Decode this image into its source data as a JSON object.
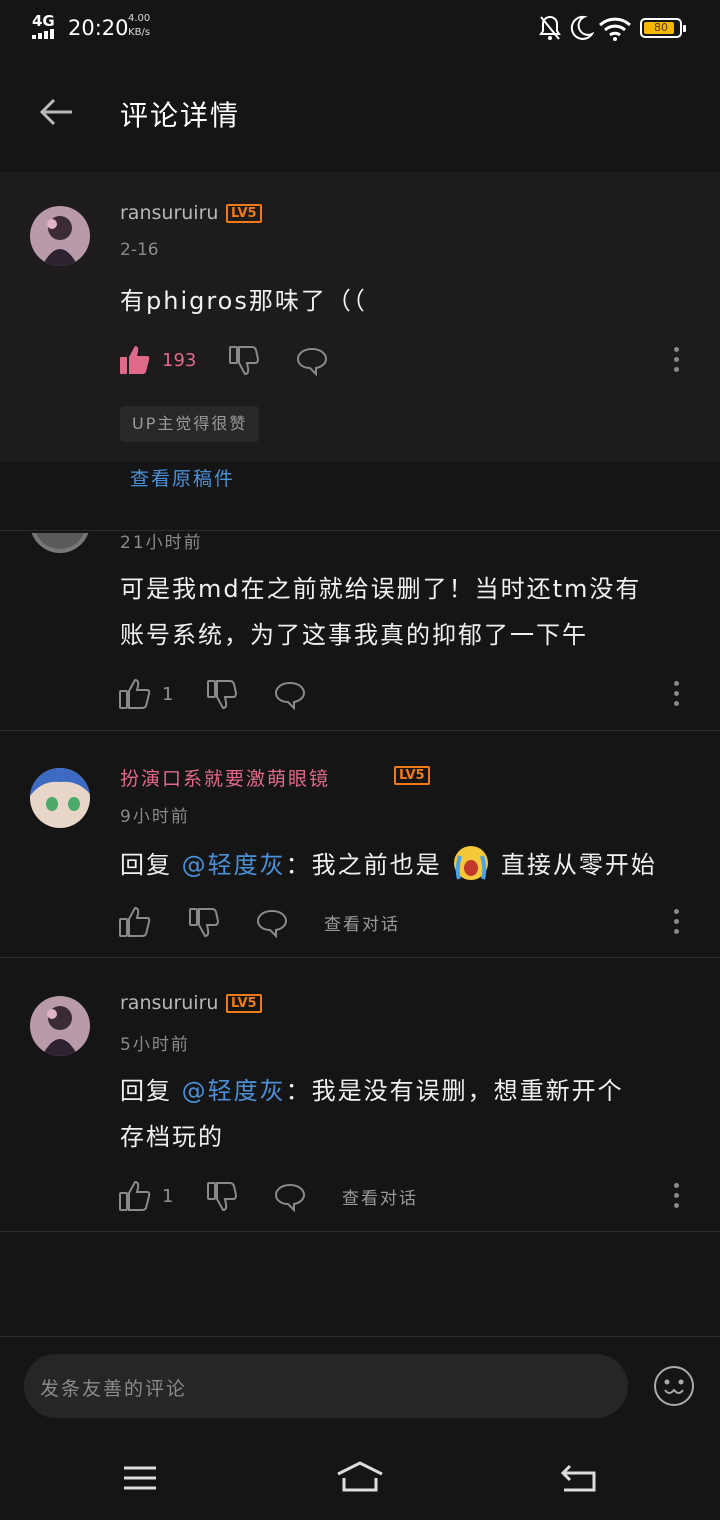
{
  "status_bar": {
    "network": "4G",
    "time": "20:20",
    "speed_value": "4.00",
    "speed_unit": "KB/s",
    "battery": "80"
  },
  "header": {
    "title": "评论详情"
  },
  "pinned": {
    "username": "ransuruiru",
    "level": "LV5",
    "date": "2-16",
    "text": "有phigros那味了（（",
    "likes": "193",
    "up_badge": "UP主觉得很赞",
    "view_original": "查看原稿件"
  },
  "comments": [
    {
      "time": "21小时前",
      "text_line1": "可是我md在之前就给误删了！当时还tm没有",
      "text_line2": "账号系统，为了这事我真的抑郁了一下午",
      "likes": "1"
    },
    {
      "username": "扮演口系就要激萌眼镜",
      "level": "LV5",
      "time": "9小时前",
      "reply_prefix": "回复",
      "mention": "@轻度灰",
      "text": "：我之前也是",
      "text_after": "直接从零开始",
      "view_conversation": "查看对话"
    },
    {
      "username": "ransuruiru",
      "level": "LV5",
      "time": "5小时前",
      "reply_prefix": "回复",
      "mention": "@轻度灰",
      "text_line1": "：我是没有误删，想重新开个",
      "text_line2": "存档玩的",
      "likes": "1",
      "view_conversation": "查看对话"
    }
  ],
  "input": {
    "placeholder": "发条友善的评论"
  },
  "colors": {
    "like_active": "#e06a8a",
    "link": "#4a90d9",
    "level": "#f07a1a"
  }
}
